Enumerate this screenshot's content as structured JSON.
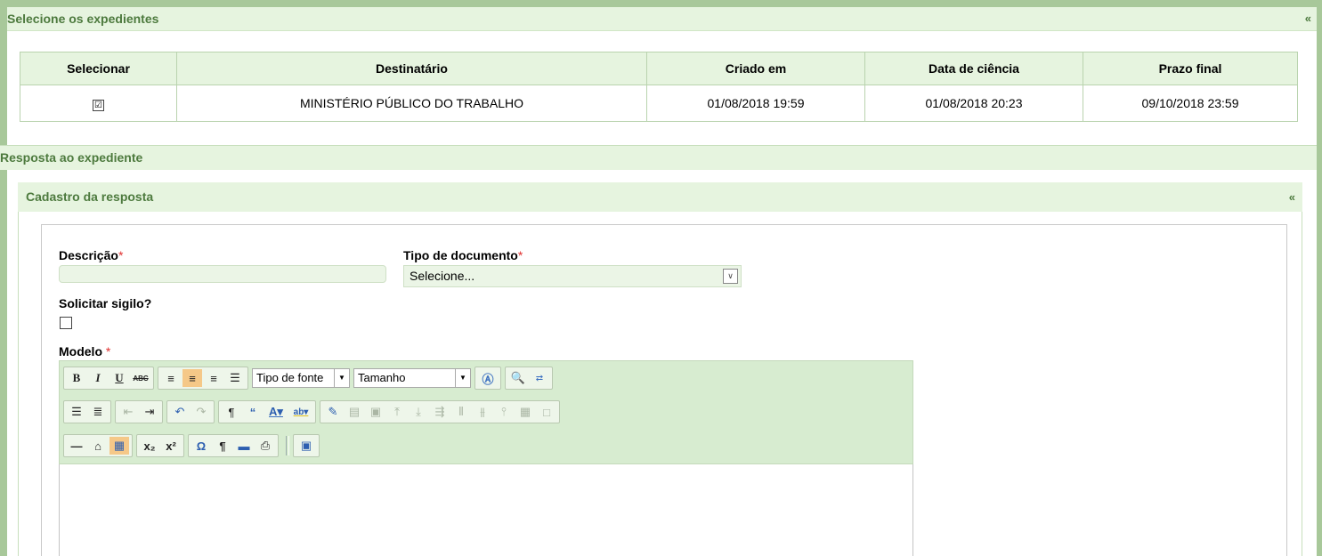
{
  "panel_expedientes": {
    "title": "Selecione os expedientes",
    "collapse_label": "«",
    "columns": [
      "Selecionar",
      "Destinatário",
      "Criado em",
      "Data de ciência",
      "Prazo final"
    ],
    "rows": [
      {
        "selected": "☑",
        "destinatario": "MINISTÉRIO PÚBLICO DO TRABALHO",
        "criado_em": "01/08/2018 19:59",
        "data_ciencia": "01/08/2018 20:23",
        "prazo_final": "09/10/2018 23:59"
      }
    ]
  },
  "resposta": {
    "title": "Resposta ao expediente"
  },
  "cadastro": {
    "title": "Cadastro da resposta",
    "collapse_label": "«",
    "descricao_label": "Descrição",
    "tipo_label": "Tipo de documento",
    "required_mark": "*",
    "tipo_selected": "Selecione...",
    "sigilo_label": "Solicitar sigilo?",
    "modelo_label": "Modelo"
  },
  "editor": {
    "font_combo": "Tipo de fonte",
    "size_combo": "Tamanho"
  },
  "colors": {
    "header_bg": "#e6f4df",
    "header_text": "#4d7a3e",
    "frame": "#a8c89a",
    "required": "#e0302f"
  }
}
